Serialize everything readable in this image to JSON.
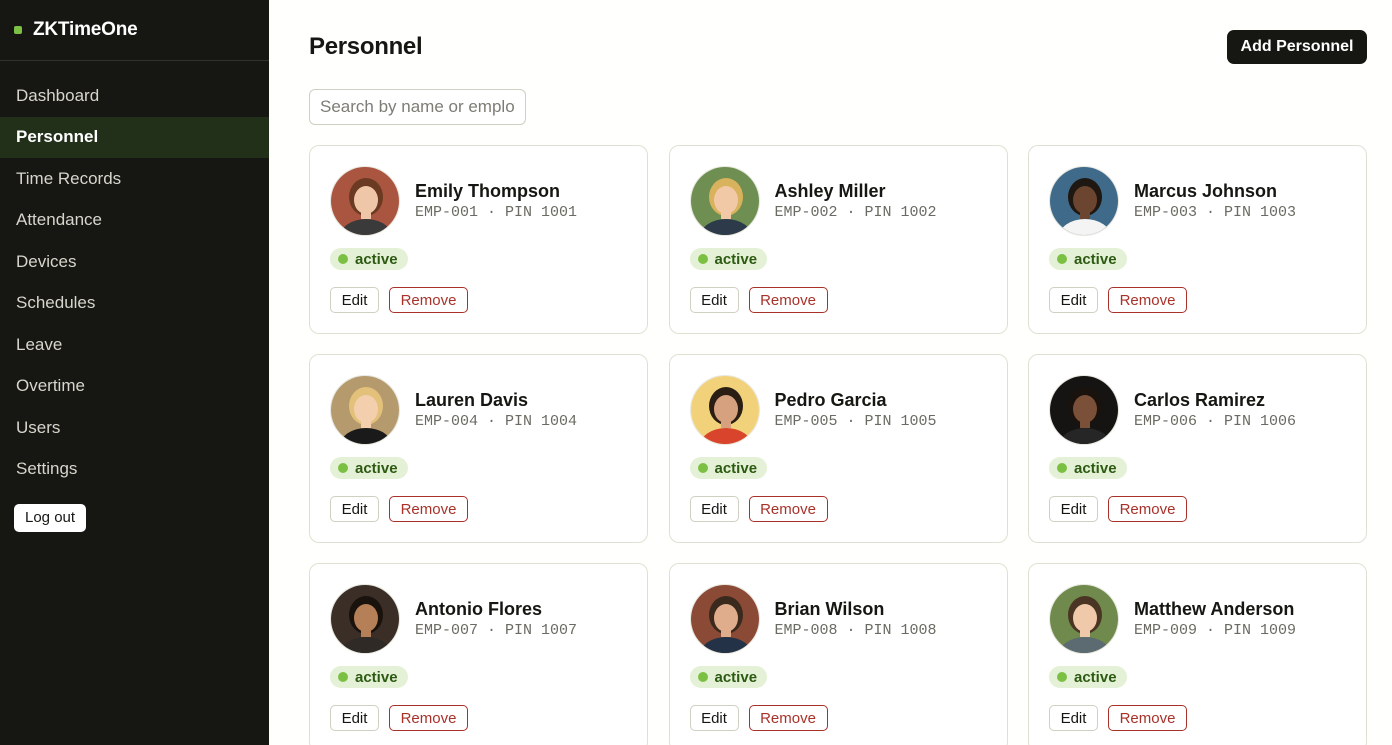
{
  "app": {
    "name": "ZKTimeOne"
  },
  "nav": {
    "items": [
      {
        "label": "Dashboard",
        "active": false
      },
      {
        "label": "Personnel",
        "active": true
      },
      {
        "label": "Time Records",
        "active": false
      },
      {
        "label": "Attendance",
        "active": false
      },
      {
        "label": "Devices",
        "active": false
      },
      {
        "label": "Schedules",
        "active": false
      },
      {
        "label": "Leave",
        "active": false
      },
      {
        "label": "Overtime",
        "active": false
      },
      {
        "label": "Users",
        "active": false
      },
      {
        "label": "Settings",
        "active": false
      }
    ],
    "logout_label": "Log out"
  },
  "page": {
    "title": "Personnel",
    "add_button": "Add Personnel",
    "search_placeholder": "Search by name or employee"
  },
  "card_labels": {
    "edit": "Edit",
    "remove": "Remove"
  },
  "personnel": [
    {
      "name": "Emily Thompson",
      "meta": "EMP-001 · PIN 1001",
      "status": "active",
      "avatar": {
        "bg": "#a9553f",
        "skin": "#f0c6a8",
        "hair": "#6b3a22",
        "shirt": "#3a3a3a"
      }
    },
    {
      "name": "Ashley Miller",
      "meta": "EMP-002 · PIN 1002",
      "status": "active",
      "avatar": {
        "bg": "#6f8f52",
        "skin": "#f2c9a6",
        "hair": "#d8b25c",
        "shirt": "#2c3a4a"
      }
    },
    {
      "name": "Marcus Johnson",
      "meta": "EMP-003 · PIN 1003",
      "status": "active",
      "avatar": {
        "bg": "#3f6a8a",
        "skin": "#6b4530",
        "hair": "#1f1712",
        "shirt": "#f4f4f4"
      }
    },
    {
      "name": "Lauren Davis",
      "meta": "EMP-004 · PIN 1004",
      "status": "active",
      "avatar": {
        "bg": "#b59a6e",
        "skin": "#f3cfae",
        "hair": "#e3c17a",
        "shirt": "#1a1a1a"
      }
    },
    {
      "name": "Pedro Garcia",
      "meta": "EMP-005 · PIN 1005",
      "status": "active",
      "avatar": {
        "bg": "#f1d27a",
        "skin": "#d6a17e",
        "hair": "#2a1d14",
        "shirt": "#d8442c"
      }
    },
    {
      "name": "Carlos Ramirez",
      "meta": "EMP-006 · PIN 1006",
      "status": "active",
      "avatar": {
        "bg": "#161412",
        "skin": "#7a5038",
        "hair": "#1a120c",
        "shirt": "#262626"
      }
    },
    {
      "name": "Antonio Flores",
      "meta": "EMP-007 · PIN 1007",
      "status": "active",
      "avatar": {
        "bg": "#3a2e26",
        "skin": "#b57f57",
        "hair": "#1a120c",
        "shirt": "#2f2a26"
      }
    },
    {
      "name": "Brian Wilson",
      "meta": "EMP-008 · PIN 1008",
      "status": "active",
      "avatar": {
        "bg": "#8b4a36",
        "skin": "#e0ad8c",
        "hair": "#3a2a1e",
        "shirt": "#233246"
      }
    },
    {
      "name": "Matthew Anderson",
      "meta": "EMP-009 · PIN 1009",
      "status": "active",
      "avatar": {
        "bg": "#6f8a4c",
        "skin": "#efc9a9",
        "hair": "#4a3524",
        "shirt": "#5c6a72"
      }
    }
  ]
}
